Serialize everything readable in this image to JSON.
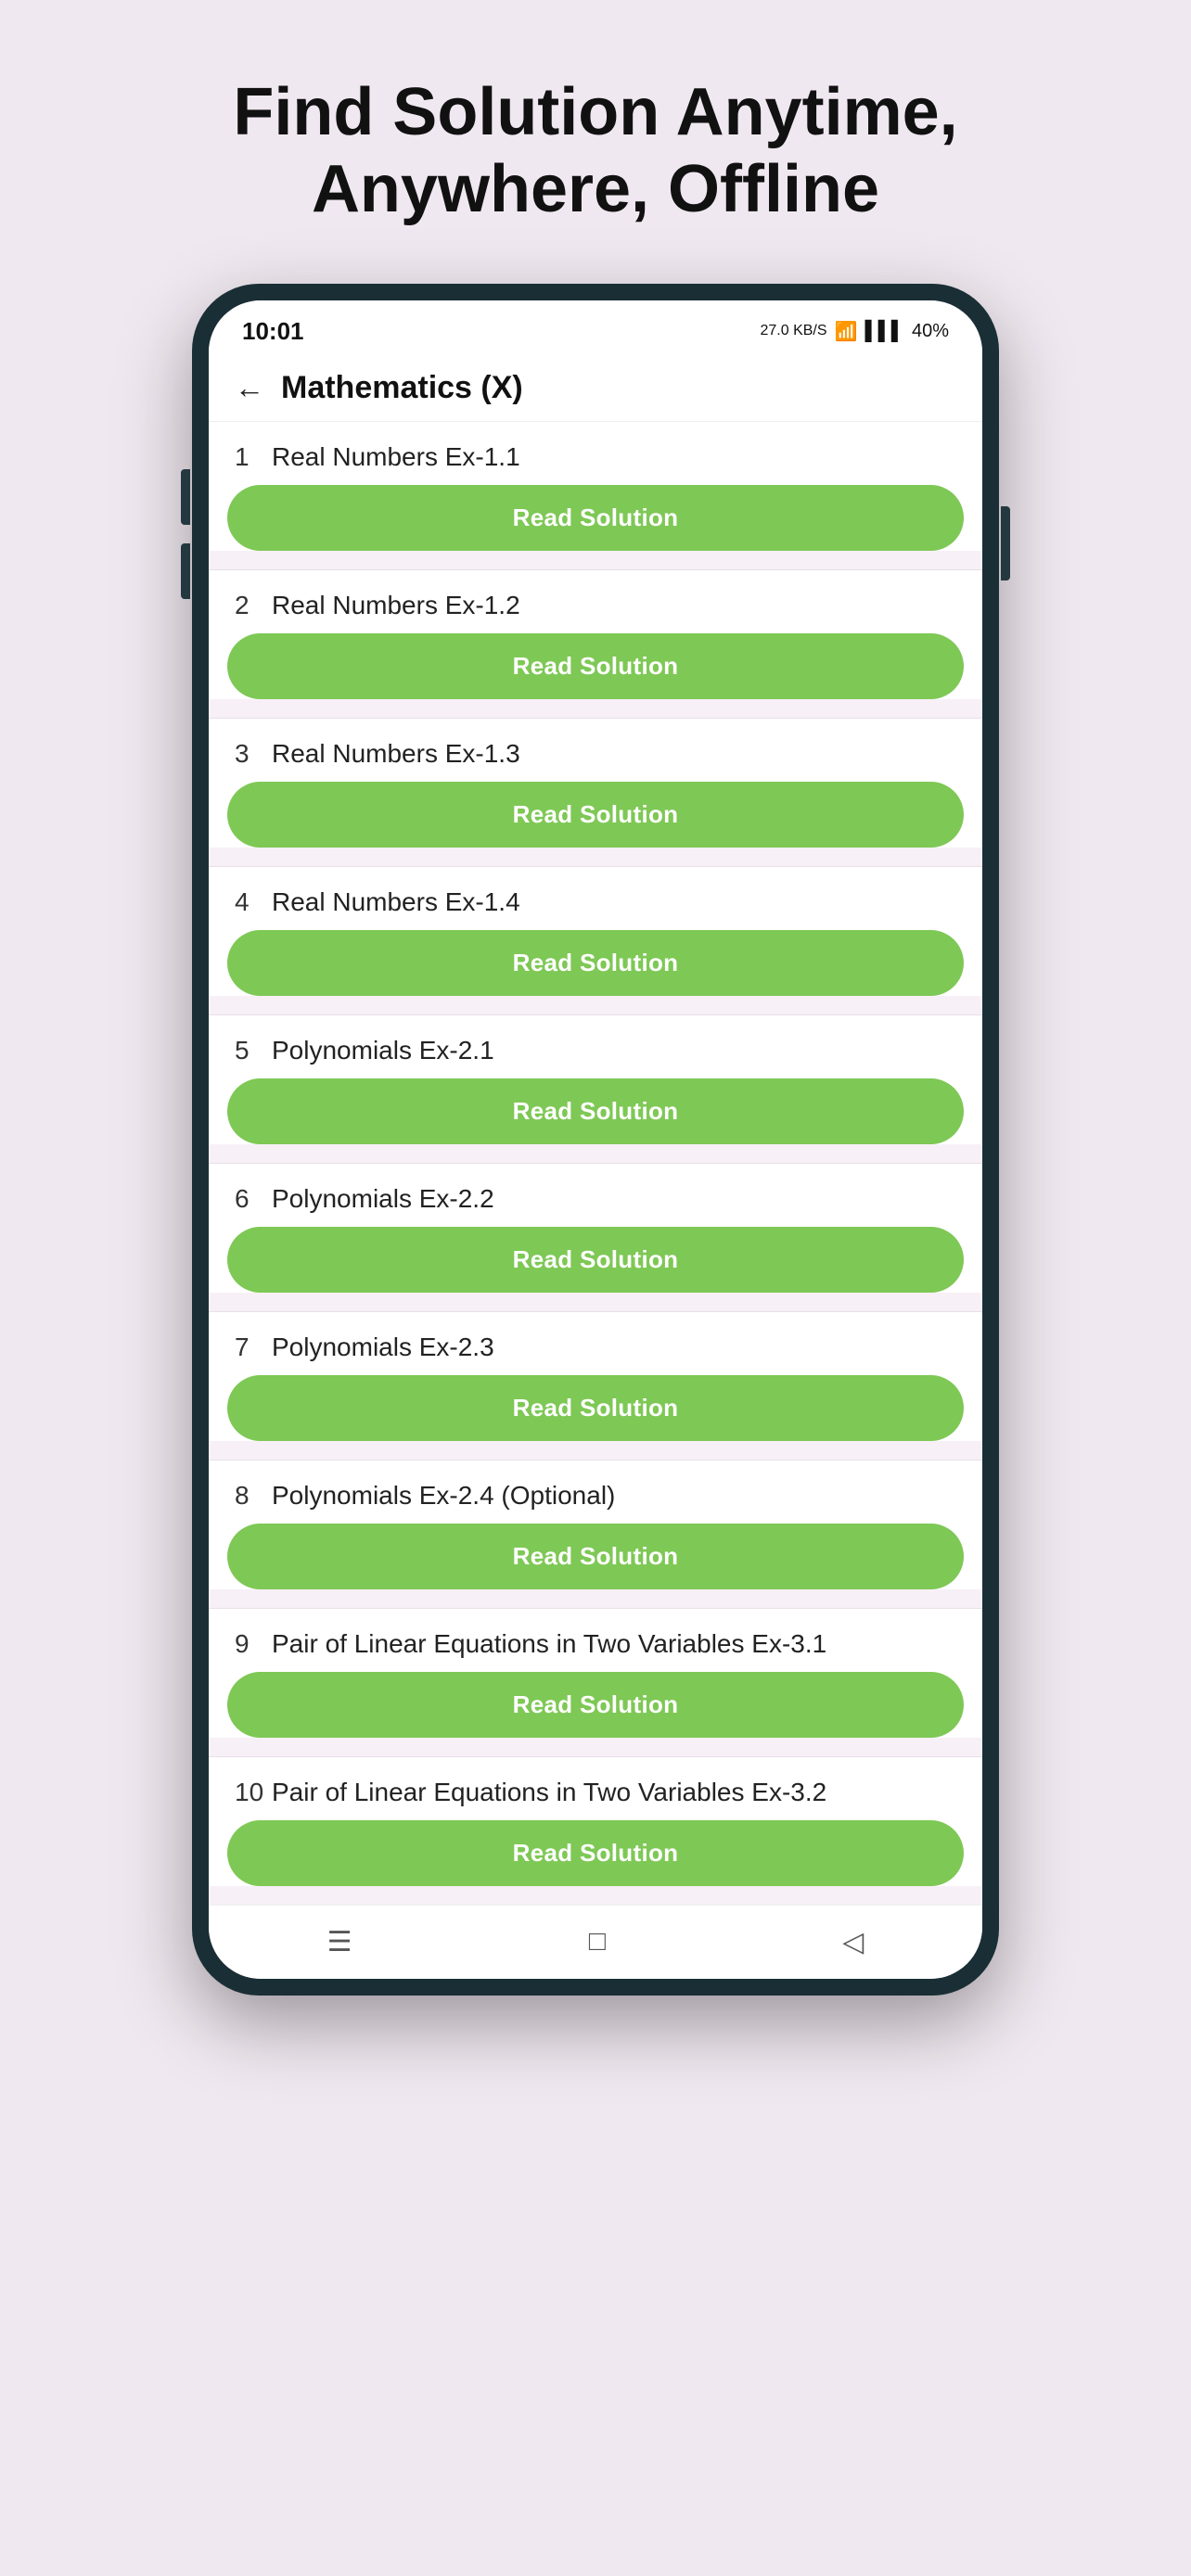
{
  "page": {
    "title": "Find Solution Anytime,\nAnywhere, Offline"
  },
  "status_bar": {
    "time": "10:01",
    "kb": "27.0\nKB/S",
    "battery": "40%"
  },
  "header": {
    "back_label": "←",
    "title": "Mathematics (X)"
  },
  "items": [
    {
      "number": "1",
      "label": "Real Numbers Ex-1.1",
      "btn": "Read Solution"
    },
    {
      "number": "2",
      "label": "Real Numbers Ex-1.2",
      "btn": "Read Solution"
    },
    {
      "number": "3",
      "label": "Real Numbers Ex-1.3",
      "btn": "Read Solution"
    },
    {
      "number": "4",
      "label": "Real Numbers Ex-1.4",
      "btn": "Read Solution"
    },
    {
      "number": "5",
      "label": "Polynomials Ex-2.1",
      "btn": "Read Solution"
    },
    {
      "number": "6",
      "label": "Polynomials Ex-2.2",
      "btn": "Read Solution"
    },
    {
      "number": "7",
      "label": "Polynomials Ex-2.3",
      "btn": "Read Solution"
    },
    {
      "number": "8",
      "label": "Polynomials Ex-2.4 (Optional)",
      "btn": "Read Solution"
    },
    {
      "number": "9",
      "label": "Pair of Linear Equations in Two Variables Ex-3.1",
      "btn": "Read Solution"
    },
    {
      "number": "10",
      "label": "Pair of Linear Equations in Two Variables Ex-3.2",
      "btn": "Read Solution"
    }
  ],
  "nav": {
    "menu_icon": "☰",
    "home_icon": "□",
    "back_icon": "◁"
  },
  "colors": {
    "bg": "#f0e8f0",
    "btn_green": "#7ec855",
    "phone_frame": "#1a2e35"
  }
}
